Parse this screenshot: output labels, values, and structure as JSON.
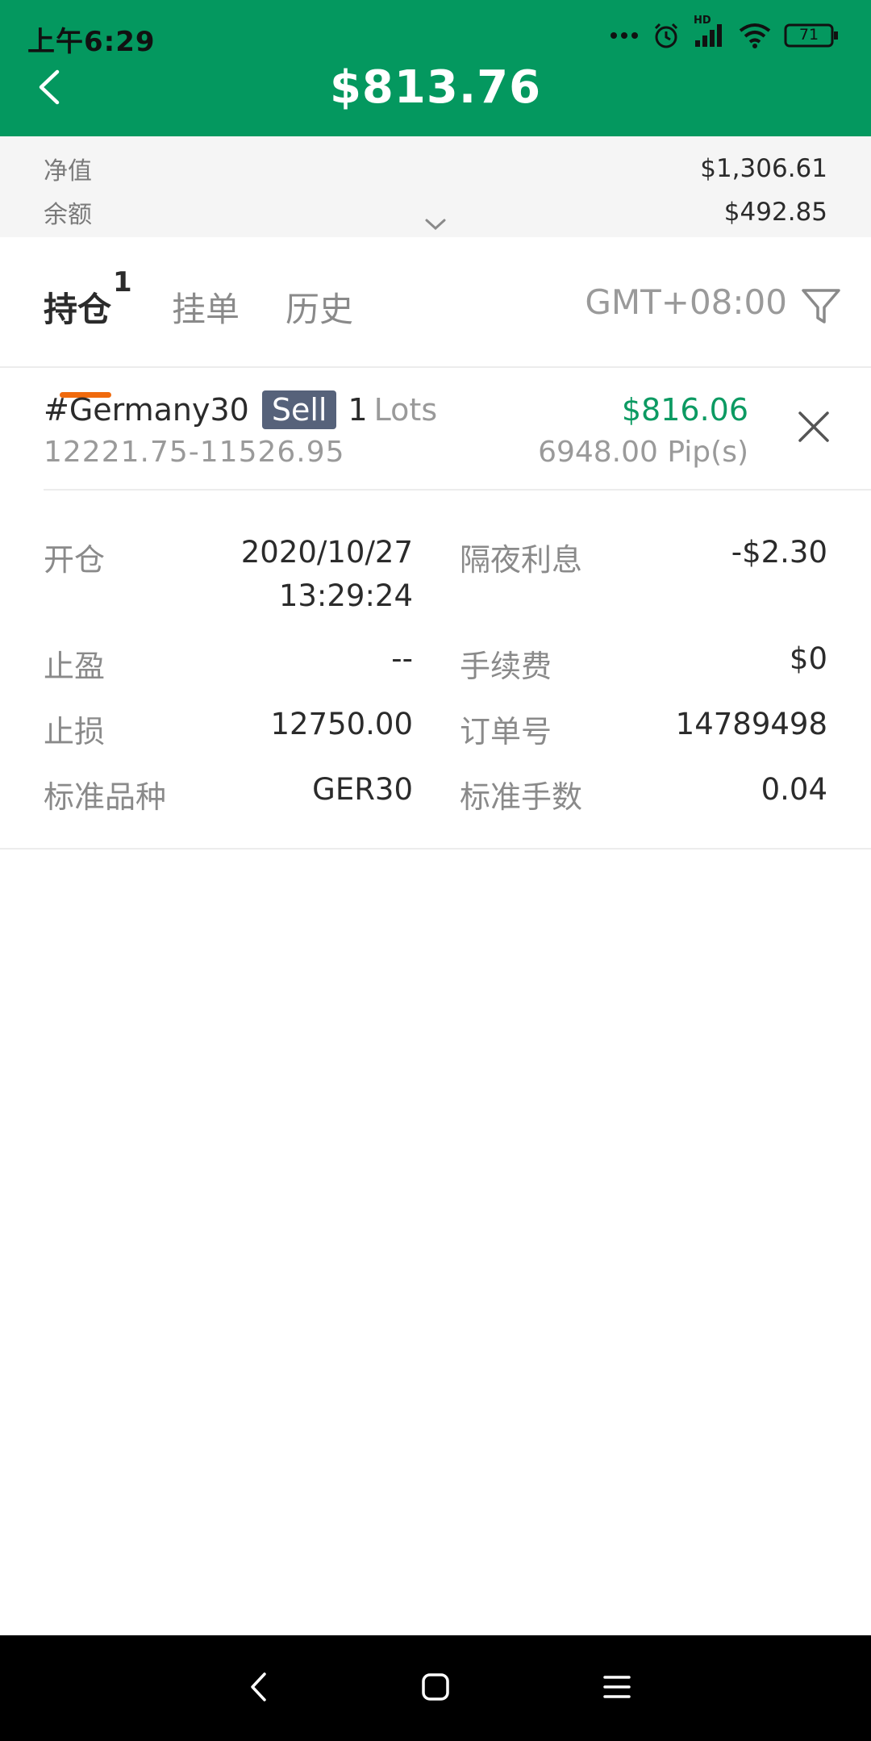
{
  "status_bar": {
    "time": "上午6:29",
    "network_label": "HD",
    "battery": "71"
  },
  "header": {
    "title": "$813.76"
  },
  "summary": {
    "equity_label": "净值",
    "equity_value": "$1,306.61",
    "balance_label": "余额",
    "balance_value": "$492.85"
  },
  "tabs": {
    "items": [
      {
        "label": "持仓",
        "count": "1",
        "active": true
      },
      {
        "label": "挂单",
        "active": false
      },
      {
        "label": "历史",
        "active": false
      }
    ],
    "timezone": "GMT+08:00"
  },
  "position": {
    "symbol": "#Germany30",
    "side": "Sell",
    "lots": "1",
    "lots_unit": "Lots",
    "price_range": "12221.75-11526.95",
    "profit": "$816.06",
    "pips": "6948.00 Pip(s)"
  },
  "details": {
    "open_label": "开仓",
    "open_date": "2020/10/27",
    "open_time": "13:29:24",
    "swap_label": "隔夜利息",
    "swap_value": "-$2.30",
    "tp_label": "止盈",
    "tp_value": "--",
    "fee_label": "手续费",
    "fee_value": "$0",
    "sl_label": "止损",
    "sl_value": "12750.00",
    "order_label": "订单号",
    "order_value": "14789498",
    "std_symbol_label": "标准品种",
    "std_symbol_value": "GER30",
    "std_lots_label": "标准手数",
    "std_lots_value": "0.04"
  },
  "colors": {
    "header_bg": "#04985f",
    "profit": "#0c9a62",
    "tab_indicator": "#f06a0d",
    "sell_badge": "#56627a"
  },
  "icons": {
    "back": "chevron-left-icon",
    "expand": "chevron-down-icon",
    "filter": "filter-icon",
    "close": "close-icon",
    "nav_back": "nav-back-icon",
    "nav_home": "nav-home-icon",
    "nav_menu": "nav-menu-icon"
  }
}
